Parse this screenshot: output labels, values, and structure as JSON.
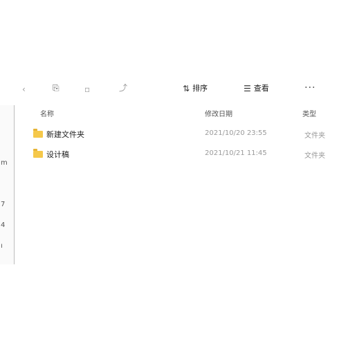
{
  "toolbar": {
    "sort_label": "排序",
    "view_label": "查看",
    "more_label": "···"
  },
  "nav": {
    "glyphs": [
      "m",
      "7",
      "4",
      "ı"
    ]
  },
  "columns": {
    "name": "名称",
    "date": "修改日期",
    "type": "类型"
  },
  "rows": [
    {
      "name": "新建文件夹",
      "date": "2021/10/20 23:55",
      "type": "文件夹"
    },
    {
      "name": "设计稿",
      "date": "2021/10/21 11:45",
      "type": "文件夹"
    }
  ]
}
